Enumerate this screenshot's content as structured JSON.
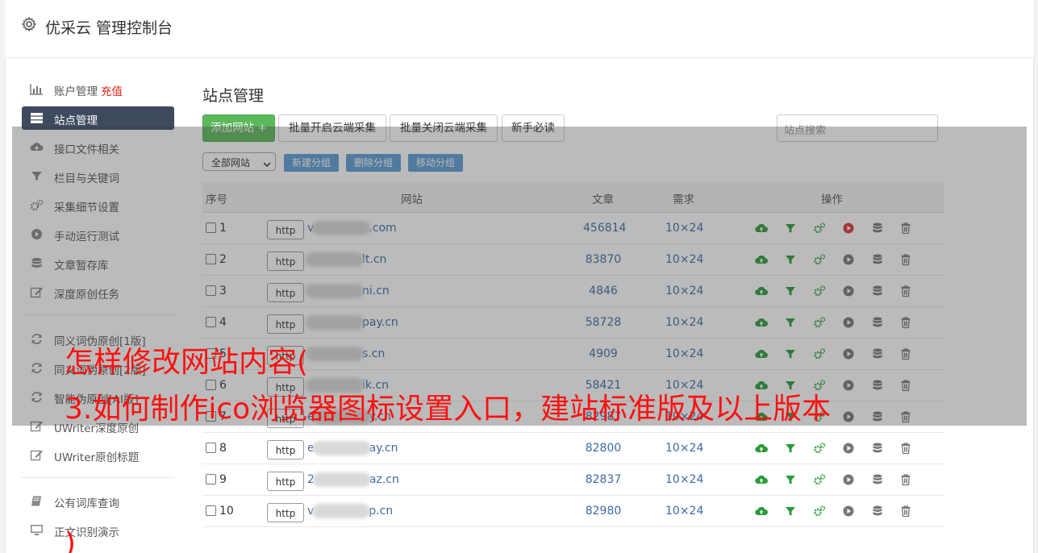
{
  "header": {
    "title": "优采云 管理控制台"
  },
  "sidebar": {
    "items": [
      {
        "label": "账户管理",
        "extra": "充值",
        "icon": "bar-chart-icon"
      },
      {
        "label": "站点管理",
        "icon": "server-icon"
      },
      {
        "label": "接口文件相关",
        "icon": "cloud-upload-icon"
      },
      {
        "label": "栏目与关键词",
        "icon": "filter-icon"
      },
      {
        "label": "采集细节设置",
        "icon": "cogs-icon"
      },
      {
        "label": "手动运行测试",
        "icon": "play-circle-icon"
      },
      {
        "label": "文章暂存库",
        "icon": "database-icon"
      },
      {
        "label": "深度原创任务",
        "icon": "edit-icon"
      },
      {
        "label": "同义词伪原创[1版]",
        "icon": "refresh-icon"
      },
      {
        "label": "同义词伪原创[2版]",
        "icon": "refresh-icon"
      },
      {
        "label": "智能伪原创[AI版]",
        "icon": "refresh-icon"
      },
      {
        "label": "UWriter深度原创",
        "icon": "edit-icon"
      },
      {
        "label": "UWriter原创标题",
        "icon": "edit-icon"
      },
      {
        "label": "公有词库查询",
        "icon": "book-icon"
      },
      {
        "label": "正文识别演示",
        "icon": "monitor-icon"
      }
    ]
  },
  "main": {
    "title": "站点管理",
    "buttons": {
      "add": "添加网站 +",
      "batch_open": "批量开启云端采集",
      "batch_close": "批量关闭云端采集",
      "newbie": "新手必读"
    },
    "search_placeholder": "站点搜索",
    "filter_select": "全部网站",
    "group_buttons": {
      "new": "新建分组",
      "delete": "删除分组",
      "move": "移动分组"
    },
    "table": {
      "headers": {
        "no": "序号",
        "site": "网站",
        "articles": "文章",
        "demand": "需求",
        "ops": "操作"
      },
      "rows": [
        {
          "no": "1",
          "http": "http",
          "site_pre": "v",
          "site_post": ".com",
          "articles": "456814",
          "demand": "10×24"
        },
        {
          "no": "2",
          "http": "http",
          "site_pre": "",
          "site_post": "lt.cn",
          "articles": "83870",
          "demand": "10×24"
        },
        {
          "no": "3",
          "http": "http",
          "site_pre": "",
          "site_post": "ni.cn",
          "articles": "4846",
          "demand": "10×24"
        },
        {
          "no": "4",
          "http": "http",
          "site_pre": "",
          "site_post": "pay.cn",
          "articles": "58728",
          "demand": "10×24"
        },
        {
          "no": "5",
          "http": "http",
          "site_pre": "",
          "site_post": "s.cn",
          "articles": "4909",
          "demand": "10×24"
        },
        {
          "no": "6",
          "http": "http",
          "site_pre": "",
          "site_post": "ik.cn",
          "articles": "58421",
          "demand": "10×24"
        },
        {
          "no": "7",
          "http": "http",
          "site_pre": "e",
          "site_post": "y.cn",
          "articles": "82987",
          "demand": "10×24"
        },
        {
          "no": "8",
          "http": "http",
          "site_pre": "e",
          "site_post": "ay.cn",
          "articles": "82800",
          "demand": "10×24"
        },
        {
          "no": "9",
          "http": "http",
          "site_pre": "2",
          "site_post": "az.cn",
          "articles": "82837",
          "demand": "10×24"
        },
        {
          "no": "10",
          "http": "http",
          "site_pre": "v",
          "site_post": "p.cn",
          "articles": "82980",
          "demand": "10×24"
        }
      ]
    }
  },
  "overlay": {
    "line1": "怎样修改网站内容(",
    "line2": "3.如何制作ico浏览器图标设置入口，建站标准版及以上版本",
    "line3": ")"
  },
  "colors": {
    "accent": "#5cb85c",
    "sidebar_active": "#3e4a5e",
    "link": "#3a6aa5",
    "group_button": "#5b9bd5",
    "overlay_text": "#ff1010",
    "op_green": "#2a9a3a",
    "op_red": "#e03030",
    "op_grey": "#777777"
  }
}
